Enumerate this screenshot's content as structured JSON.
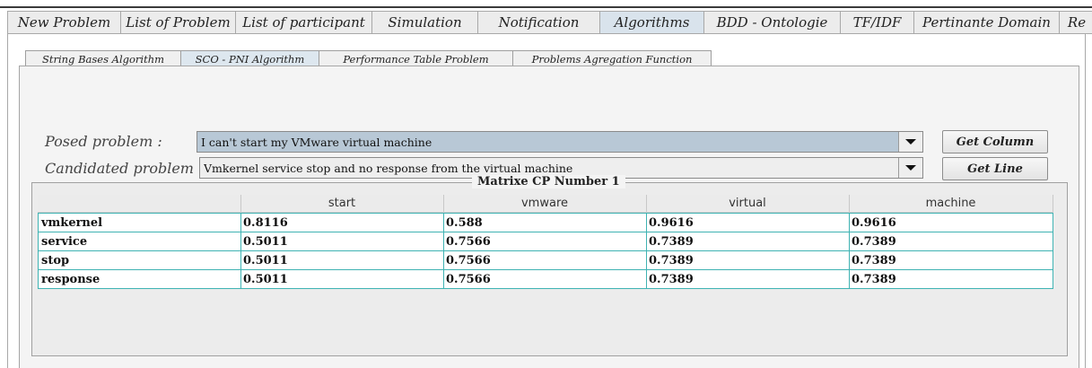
{
  "main_tabs": [
    "New Problem",
    "List of Problem",
    "List of participant",
    "Simulation",
    "Notification",
    "Algorithms",
    "BDD - Ontologie",
    "TF/IDF",
    "Pertinante Domain",
    "Re"
  ],
  "main_active": 5,
  "sub_tabs": [
    "String Bases Algorithm",
    "SCO - PNI Algorithm",
    "Performance Table Problem",
    "Problems Agregation Function"
  ],
  "sub_active": 1,
  "form": {
    "posed_label": "Posed problem :",
    "posed_value": "I can't start my VMware virtual machine",
    "candidated_label": "Candidated problem :",
    "candidated_value": "Vmkernel service stop and no response from the virtual machine",
    "get_column": "Get Column",
    "get_line": "Get Line"
  },
  "matrix": {
    "title": "Matrixe CP Number 1",
    "columns": [
      "",
      "start",
      "vmware",
      "virtual",
      "machine"
    ],
    "rows": [
      [
        "vmkernel",
        "0.8116",
        "0.588",
        "0.9616",
        "0.9616"
      ],
      [
        "service",
        "0.5011",
        "0.7566",
        "0.7389",
        "0.7389"
      ],
      [
        "stop",
        "0.5011",
        "0.7566",
        "0.7389",
        "0.7389"
      ],
      [
        "response",
        "0.5011",
        "0.7566",
        "0.7389",
        "0.7389"
      ]
    ]
  },
  "icons": {
    "dropdown": "chevron-down-icon"
  }
}
